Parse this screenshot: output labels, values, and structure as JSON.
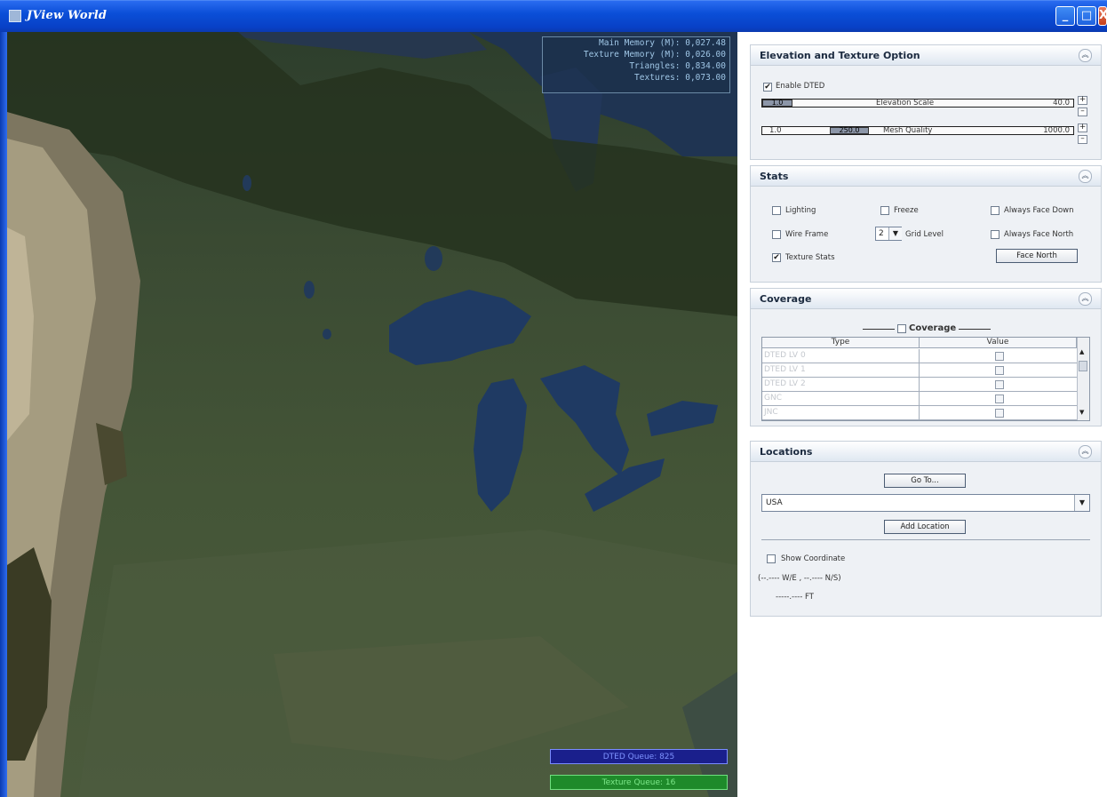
{
  "window": {
    "title": "JView World",
    "minimize_label": "_",
    "maximize_label": "□",
    "close_label": "X"
  },
  "hud": {
    "main_memory": "Main Memory (M): 0,027.48",
    "texture_memory": "Texture Memory (M): 0,026.00",
    "triangles": "Triangles: 0,834.00",
    "textures": "Textures: 0,073.00"
  },
  "queues": {
    "dted": "DTED Queue: 825",
    "texture": "Texture Queue: 16"
  },
  "elevation": {
    "title": "Elevation and Texture Option",
    "enable_dted_label": "Enable DTED",
    "enable_dted_checked": true,
    "scale_min": "1.0",
    "scale_label": "Elevation Scale",
    "scale_max": "40.0",
    "quality_min": "1.0",
    "quality_value": "250.0",
    "quality_label": "Mesh Quality",
    "quality_max": "1000.0",
    "plus": "+",
    "minus": "–"
  },
  "stats": {
    "title": "Stats",
    "lighting": "Lighting",
    "freeze": "Freeze",
    "always_face_down": "Always Face Down",
    "wire_frame": "Wire Frame",
    "grid_value": "2",
    "grid_label": "Grid Level",
    "always_face_north": "Always Face North",
    "texture_stats": "Texture Stats",
    "texture_stats_checked": true,
    "face_north_button": "Face North"
  },
  "coverage": {
    "title": "Coverage",
    "group_label": "Coverage",
    "col_type": "Type",
    "col_value": "Value",
    "rows": [
      "DTED LV 0",
      "DTED LV 1",
      "DTED LV 2",
      "GNC",
      "JNC"
    ]
  },
  "locations": {
    "title": "Locations",
    "goto_button": "Go To...",
    "selected": "USA",
    "add_button": "Add Location",
    "show_coordinate": "Show Coordinate",
    "coord_text": "(--.---- W/E , --.---- N/S)",
    "alt_text": "-----.---- FT"
  },
  "colors": {
    "titlebar": "#0b4fd8",
    "dted_queue": "#1a1f8c",
    "texture_queue": "#1e8a2a"
  }
}
